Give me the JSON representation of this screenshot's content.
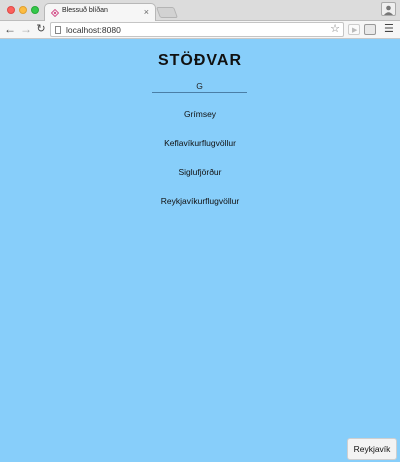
{
  "browser": {
    "tab_title": "Blessuð blíðan",
    "tab_close": "×",
    "url": "localhost:8080",
    "icons": [
      "back-arrow-icon",
      "forward-arrow-icon",
      "reload-icon",
      "star-icon",
      "menu-icon"
    ]
  },
  "page": {
    "title": "STÖÐVAR",
    "search_value": "G",
    "stations": [
      "Grímsey",
      "Keflavíkurflugvöllur",
      "Siglufjörður",
      "Reykjavíkurflugvöllur"
    ],
    "location_button": "Reykjavík",
    "background_color": "#87cefa"
  }
}
